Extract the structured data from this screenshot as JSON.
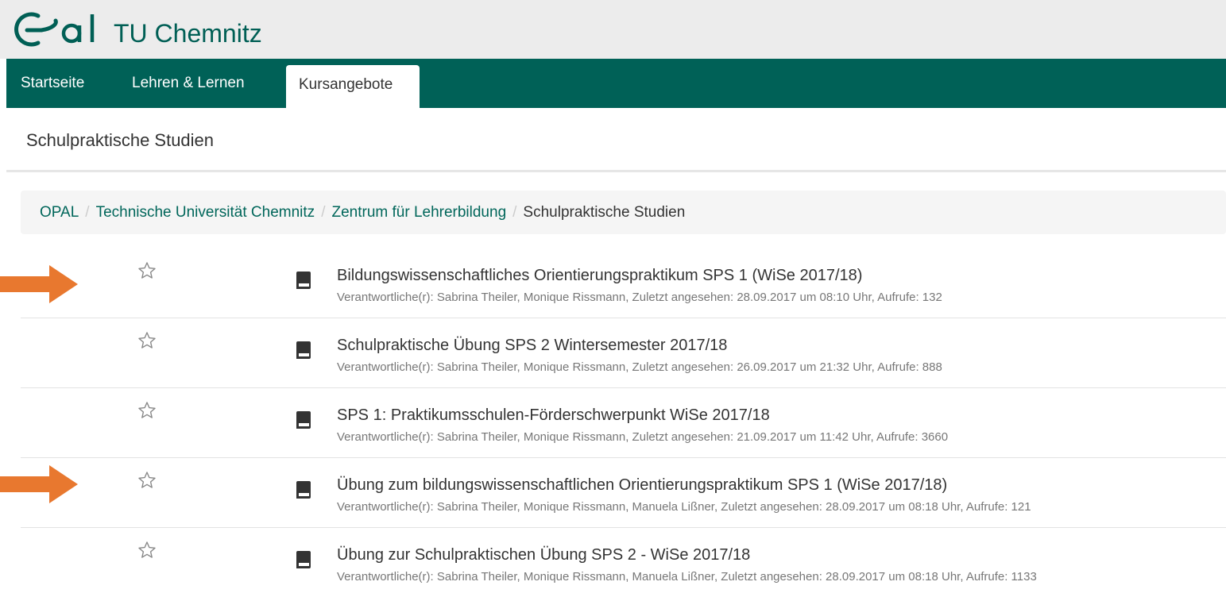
{
  "brand": {
    "logo_text": "OPAL",
    "title": "TU Chemnitz",
    "color": "#005f55"
  },
  "nav": {
    "items": [
      {
        "label": "Startseite"
      },
      {
        "label": "Lehren & Lernen"
      },
      {
        "label": "Kursangebote",
        "active": true
      }
    ]
  },
  "page_title": "Schulpraktische Studien",
  "breadcrumb": {
    "links": [
      "OPAL",
      "Technische Universität Chemnitz",
      "Zentrum für Lehrerbildung"
    ],
    "current": "Schulpraktische Studien",
    "separator": "/"
  },
  "courses": [
    {
      "title": "Bildungswissenschaftliches Orientierungspraktikum SPS 1 (WiSe 2017/18)",
      "meta": "Verantwortliche(r): Sabrina Theiler, Monique Rissmann, Zuletzt angesehen: 28.09.2017 um 08:10 Uhr, Aufrufe: 132"
    },
    {
      "title": "Schulpraktische Übung SPS 2 Wintersemester 2017/18",
      "meta": "Verantwortliche(r): Sabrina Theiler, Monique Rissmann, Zuletzt angesehen: 26.09.2017 um 21:32 Uhr, Aufrufe: 888"
    },
    {
      "title": "SPS 1: Praktikumsschulen-Förderschwerpunkt WiSe 2017/18",
      "meta": "Verantwortliche(r): Sabrina Theiler, Monique Rissmann, Zuletzt angesehen: 21.09.2017 um 11:42 Uhr, Aufrufe: 3660"
    },
    {
      "title": "Übung zum bildungswissenschaftlichen Orientierungspraktikum SPS 1 (WiSe 2017/18)",
      "meta": "Verantwortliche(r): Sabrina Theiler, Monique Rissmann, Manuela Lißner, Zuletzt angesehen: 28.09.2017 um 08:18 Uhr, Aufrufe: 121"
    },
    {
      "title": "Übung zur Schulpraktischen Übung SPS 2 - WiSe 2017/18",
      "meta": "Verantwortliche(r): Sabrina Theiler, Monique Rissmann, Manuela Lißner, Zuletzt angesehen: 28.09.2017 um 08:18 Uhr, Aufrufe: 1133"
    }
  ],
  "icons": {
    "favorite": "star-outline-icon",
    "course": "book-icon",
    "annotation": "arrow-right-icon"
  },
  "colors": {
    "nav_bg": "#006157",
    "link": "#00665a",
    "arrow": "#e8782f"
  }
}
